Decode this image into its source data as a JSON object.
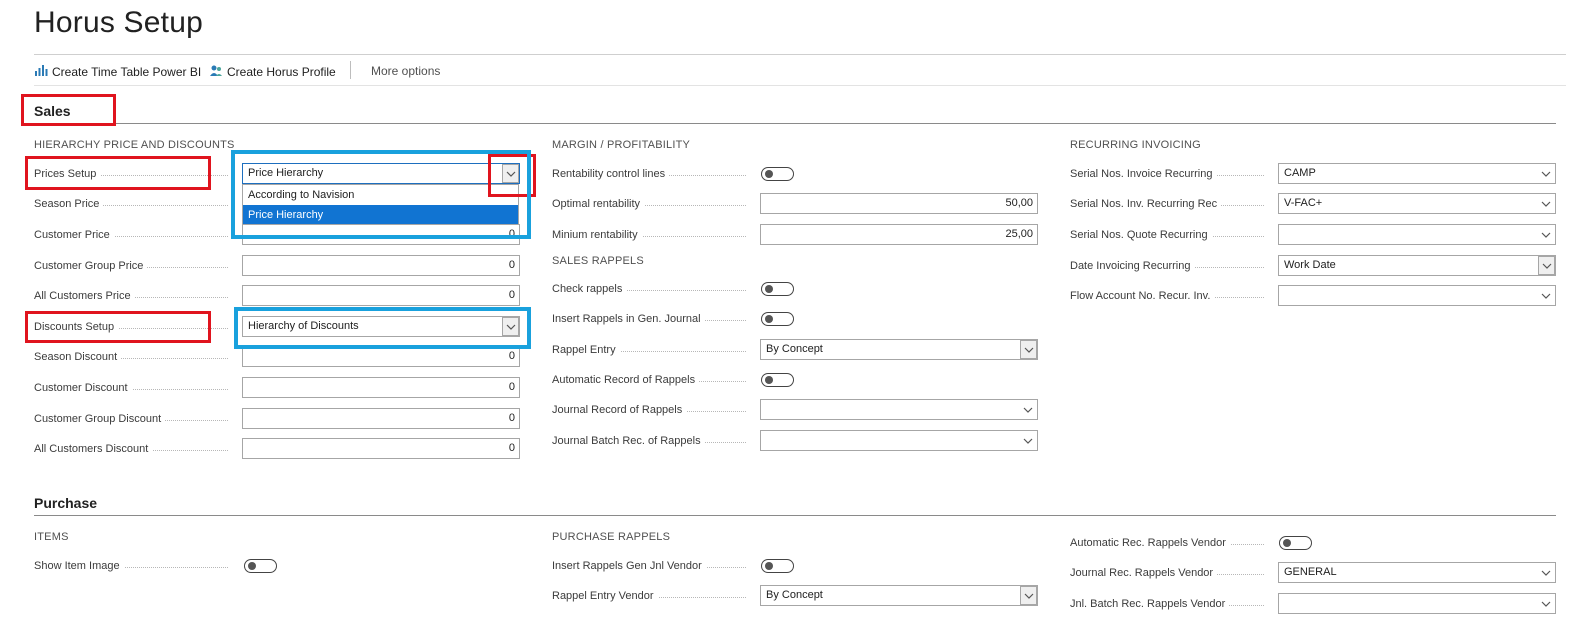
{
  "page": {
    "title": "Horus Setup"
  },
  "actions": {
    "create_time_table": "Create Time Table Power BI",
    "create_profile": "Create Horus Profile",
    "more_options": "More options"
  },
  "sales": {
    "title": "Sales",
    "hierarchy": {
      "title": "HIERARCHY PRICE AND DISCOUNTS",
      "prices_setup": {
        "label": "Prices Setup",
        "value": "Price Hierarchy",
        "options": [
          "According to Navision",
          "Price Hierarchy"
        ]
      },
      "season_price": {
        "label": "Season Price",
        "value": ""
      },
      "customer_price": {
        "label": "Customer Price",
        "value": "0"
      },
      "customer_group_price": {
        "label": "Customer Group Price",
        "value": "0"
      },
      "all_customers_price": {
        "label": "All Customers Price",
        "value": "0"
      },
      "discounts_setup": {
        "label": "Discounts Setup",
        "value": "Hierarchy of Discounts"
      },
      "season_discount": {
        "label": "Season Discount",
        "value": "0"
      },
      "customer_discount": {
        "label": "Customer Discount",
        "value": "0"
      },
      "customer_group_discount": {
        "label": "Customer Group Discount",
        "value": "0"
      },
      "all_customers_discount": {
        "label": "All Customers Discount",
        "value": "0"
      }
    },
    "margin": {
      "title": "MARGIN / PROFITABILITY",
      "rentability_control": {
        "label": "Rentability control lines",
        "on": false
      },
      "optimal": {
        "label": "Optimal rentability",
        "value": "50,00"
      },
      "minimum": {
        "label": "Minium rentability",
        "value": "25,00"
      }
    },
    "rappels": {
      "title": "SALES RAPPELS",
      "check": {
        "label": "Check rappels",
        "on": false
      },
      "insert_gen": {
        "label": "Insert Rappels in Gen. Journal",
        "on": false
      },
      "entry": {
        "label": "Rappel Entry",
        "value": "By Concept"
      },
      "auto_record": {
        "label": "Automatic Record of Rappels",
        "on": false
      },
      "journal_record": {
        "label": "Journal Record of Rappels",
        "value": ""
      },
      "journal_batch": {
        "label": "Journal Batch Rec. of Rappels",
        "value": ""
      }
    },
    "recurring": {
      "title": "RECURRING INVOICING",
      "serial_invoice": {
        "label": "Serial Nos. Invoice Recurring",
        "value": "CAMP"
      },
      "serial_inv_rec": {
        "label": "Serial Nos. Inv. Recurring Rec",
        "value": "V-FAC+"
      },
      "serial_quote": {
        "label": "Serial Nos. Quote Recurring",
        "value": ""
      },
      "date_invoicing": {
        "label": "Date Invoicing Recurring",
        "value": "Work Date"
      },
      "flow_account": {
        "label": "Flow Account No. Recur. Inv.",
        "value": ""
      }
    }
  },
  "purchase": {
    "title": "Purchase",
    "items": {
      "title": "ITEMS",
      "show_image": {
        "label": "Show Item Image",
        "on": false
      }
    },
    "rappels": {
      "title": "PURCHASE RAPPELS",
      "insert_gen": {
        "label": "Insert Rappels Gen Jnl Vendor",
        "on": false
      },
      "entry_vendor": {
        "label": "Rappel Entry Vendor",
        "value": "By Concept"
      }
    },
    "vendor": {
      "auto_rec": {
        "label": "Automatic Rec. Rappels Vendor",
        "on": false
      },
      "journal_rec": {
        "label": "Journal Rec. Rappels Vendor",
        "value": "GENERAL"
      },
      "batch_rec": {
        "label": "Jnl. Batch Rec. Rappels Vendor",
        "value": ""
      }
    }
  },
  "colors": {
    "highlight_red": "#e0141e",
    "highlight_blue": "#19a1dd",
    "selection": "#1174d2"
  },
  "icons": [
    "bar-chart-icon",
    "people-icon",
    "chevron-down-icon"
  ]
}
